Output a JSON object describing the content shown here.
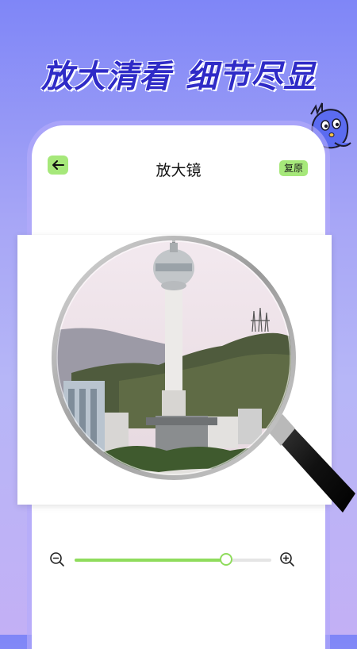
{
  "promo": {
    "headline_left": "放大清看",
    "headline_right": "细节尽显"
  },
  "header": {
    "title": "放大镜",
    "restore_label": "复原",
    "back_icon": "arrow-left-icon"
  },
  "zoom": {
    "level_fraction": 0.77,
    "minus_icon": "zoom-out-icon",
    "plus_icon": "zoom-in-icon"
  },
  "colors": {
    "accent_green": "#a6e87a",
    "headline_blue": "#2f2bc7",
    "background_top": "#7f86f7"
  }
}
